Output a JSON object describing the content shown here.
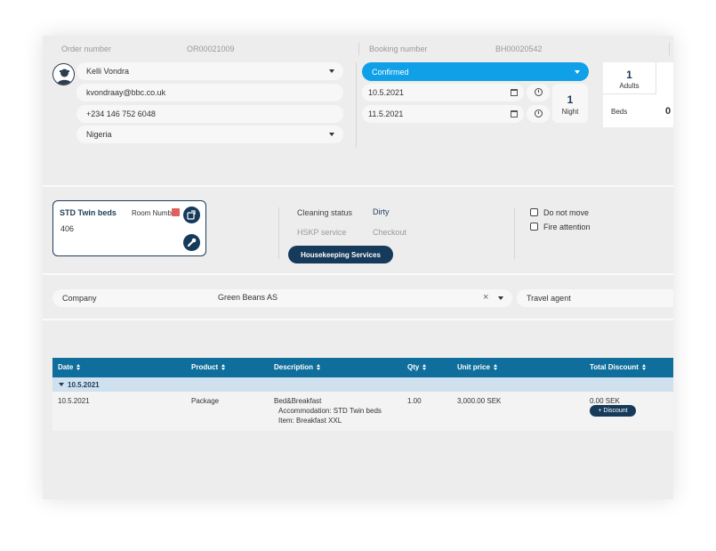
{
  "header": {
    "order_label": "Order number",
    "order_value": "OR00021009",
    "booking_label": "Booking number",
    "booking_value": "BH00020542"
  },
  "guest": {
    "name": "Kelli Vondra",
    "email": "kvondraay@bbc.co.uk",
    "phone": "+234 146 752 6048",
    "country": "Nigeria"
  },
  "reservation": {
    "status": "Confirmed",
    "arrival": "10.5.2021",
    "departure": "11.5.2021",
    "nights_count": "1",
    "nights_label": "Night"
  },
  "occupancy": {
    "adults_count": "1",
    "adults_label": "Adults",
    "beds_label": "Beds",
    "beds_value": "0"
  },
  "room": {
    "type": "STD Twin beds",
    "room_number_label": "Room Numb",
    "number": "406"
  },
  "housekeeping": {
    "cleaning_label": "Cleaning status",
    "cleaning_value": "Dirty",
    "hskp_label": "HSKP service",
    "hskp_value": "Checkout",
    "button_label": "Housekeeping Services"
  },
  "flags": {
    "do_not_move": "Do not move",
    "fire_attention": "Fire attention"
  },
  "company": {
    "label": "Company",
    "value": "Green Beans AS",
    "clear": "×",
    "travel_agent_label": "Travel agent"
  },
  "table": {
    "columns": [
      "Date",
      "Product",
      "Description",
      "Qty",
      "Unit price",
      "Total Discount"
    ],
    "group_date": "10.5.2021",
    "rows": [
      {
        "date": "10.5.2021",
        "product": "Package",
        "description": "Bed&Breakfast",
        "desc_line2": "Accommodation: STD Twin beds",
        "desc_line3": "Item: Breakfast XXL",
        "qty": "1.00",
        "unit_price": "3,000.00 SEK",
        "total_discount": "0.00 SEK",
        "discount_button": "+ Discount"
      }
    ]
  },
  "colors": {
    "accent_blue": "#0fa0e8",
    "navy": "#163a5a",
    "table_header": "#0f6e9c",
    "group_row": "#cfe0ef"
  }
}
